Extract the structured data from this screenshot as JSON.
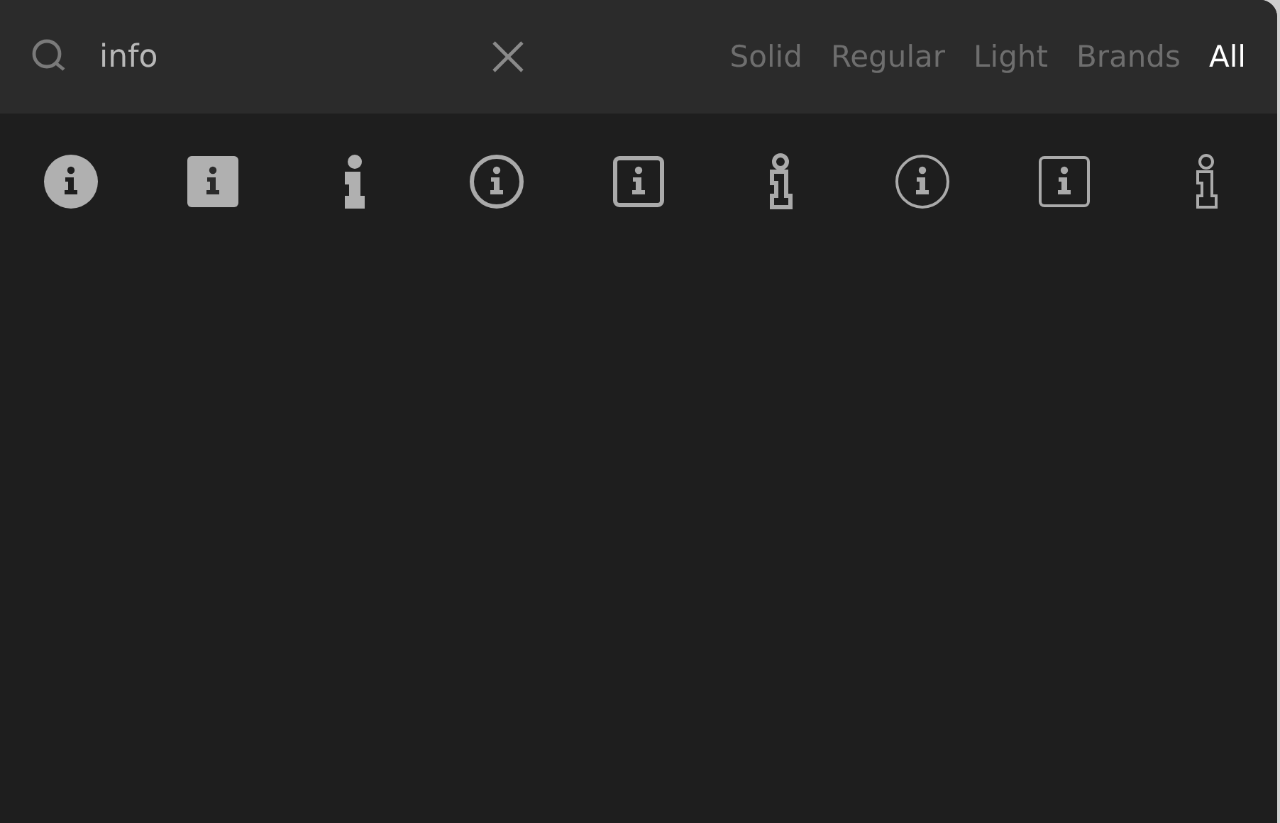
{
  "search": {
    "value": "info"
  },
  "tabs": [
    {
      "label": "Solid",
      "selected": false
    },
    {
      "label": "Regular",
      "selected": false
    },
    {
      "label": "Light",
      "selected": false
    },
    {
      "label": "Brands",
      "selected": false
    },
    {
      "label": "All",
      "selected": true
    }
  ],
  "icons": [
    {
      "kind": "disc"
    },
    {
      "kind": "tile"
    },
    {
      "kind": "glyph"
    },
    {
      "kind": "ring"
    },
    {
      "kind": "frame"
    },
    {
      "kind": "outline"
    },
    {
      "kind": "thinring"
    },
    {
      "kind": "thinframe"
    },
    {
      "kind": "thinoutline"
    }
  ]
}
